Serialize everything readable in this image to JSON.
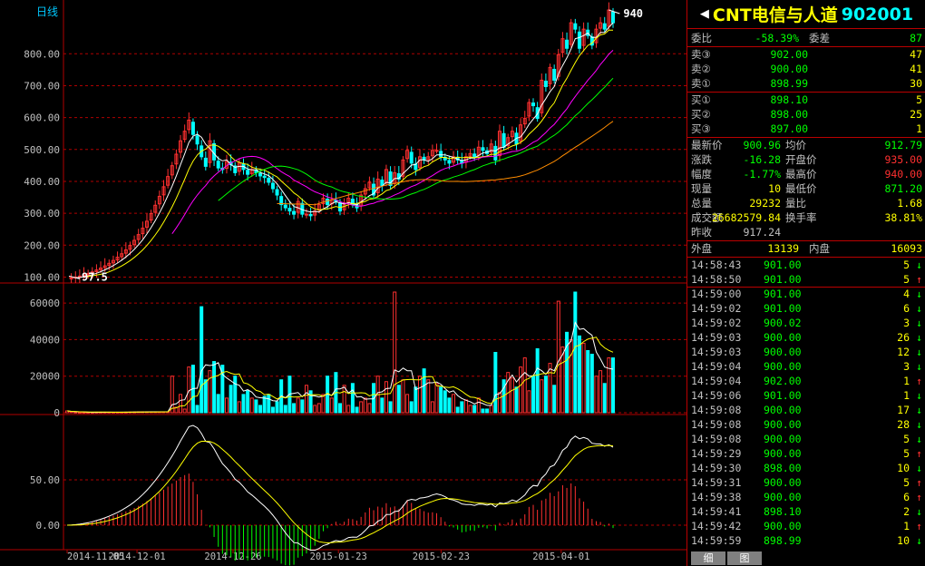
{
  "header": {
    "period": "日线",
    "stock_name": "CNT电信与人道",
    "stock_code": "902001",
    "triangle_left": "◀",
    "triangle_right": "▶"
  },
  "price_axis": [
    "800.00",
    "700.00",
    "600.00",
    "500.00",
    "400.00",
    "300.00",
    "200.00",
    "100.00"
  ],
  "volume_axis": [
    "60000",
    "40000",
    "20000",
    "0"
  ],
  "macd_axis": [
    "50.00",
    "0.00"
  ],
  "date_axis": [
    "2014-11-05",
    "2014-12-01",
    "2014-12-26",
    "2015-01-23",
    "2015-02-23",
    "2015-04-01"
  ],
  "annotations": {
    "high": "940",
    "low": "97.5"
  },
  "colors": {
    "up": "#ff3030",
    "down": "#00ffff",
    "grid": "#b00000",
    "ma5": "#ffffff",
    "ma10": "#ffff00",
    "ma20": "#ff00ff",
    "ma30": "#00ff00",
    "ma60": "#ff8c00"
  },
  "order_book": {
    "weibi_label": "委比",
    "weibi_value": "-58.39%",
    "weicha_label": "委差",
    "weicha_value": "87",
    "asks": [
      {
        "label": "卖③",
        "price": "902.00",
        "qty": "47"
      },
      {
        "label": "卖②",
        "price": "900.00",
        "qty": "41"
      },
      {
        "label": "卖①",
        "price": "898.99",
        "qty": "30"
      }
    ],
    "bids": [
      {
        "label": "买①",
        "price": "898.10",
        "qty": "5"
      },
      {
        "label": "买②",
        "price": "898.00",
        "qty": "25"
      },
      {
        "label": "买③",
        "price": "897.00",
        "qty": "1"
      }
    ]
  },
  "quote": {
    "rows": [
      {
        "l1": "最新价",
        "v1": "900.96",
        "l2": "均价",
        "v2": "912.79",
        "c1": "#00ff00",
        "c2": "#00ff00"
      },
      {
        "l1": "涨跌",
        "v1": "-16.28",
        "l2": "开盘价",
        "v2": "935.00",
        "c1": "#00ff00",
        "c2": "#ff3030"
      },
      {
        "l1": "幅度",
        "v1": "-1.77%",
        "l2": "最高价",
        "v2": "940.00",
        "c1": "#00ff00",
        "c2": "#ff3030"
      },
      {
        "l1": "现量",
        "v1": "10",
        "l2": "最低价",
        "v2": "871.20",
        "c1": "#ffff00",
        "c2": "#00ff00"
      },
      {
        "l1": "总量",
        "v1": "29232",
        "l2": "量比",
        "v2": "1.68",
        "c1": "#ffff00",
        "c2": "#ffff00"
      },
      {
        "l1": "成交额",
        "v1": "26682579.84",
        "l2": "换手率",
        "v2": "38.81%",
        "c1": "#ffff00",
        "c2": "#ffff00"
      }
    ],
    "prev_close_label": "昨收",
    "prev_close": "917.24",
    "outer_label": "外盘",
    "outer_value": "13139",
    "inner_label": "内盘",
    "inner_value": "16093"
  },
  "ticks": [
    {
      "time": "14:58:43",
      "price": "901.00",
      "qty": "5",
      "dir": "down"
    },
    {
      "time": "14:58:50",
      "price": "901.00",
      "qty": "5",
      "dir": "up"
    },
    {
      "time": "14:59:00",
      "price": "901.00",
      "qty": "4",
      "dir": "down"
    },
    {
      "time": "14:59:02",
      "price": "901.00",
      "qty": "6",
      "dir": "down"
    },
    {
      "time": "14:59:02",
      "price": "900.02",
      "qty": "3",
      "dir": "down"
    },
    {
      "time": "14:59:03",
      "price": "900.00",
      "qty": "26",
      "dir": "down"
    },
    {
      "time": "14:59:03",
      "price": "900.00",
      "qty": "12",
      "dir": "down"
    },
    {
      "time": "14:59:04",
      "price": "900.00",
      "qty": "3",
      "dir": "down"
    },
    {
      "time": "14:59:04",
      "price": "902.00",
      "qty": "1",
      "dir": "up"
    },
    {
      "time": "14:59:06",
      "price": "901.00",
      "qty": "1",
      "dir": "down"
    },
    {
      "time": "14:59:08",
      "price": "900.00",
      "qty": "17",
      "dir": "down"
    },
    {
      "time": "14:59:08",
      "price": "900.00",
      "qty": "28",
      "dir": "down"
    },
    {
      "time": "14:59:08",
      "price": "900.00",
      "qty": "5",
      "dir": "down"
    },
    {
      "time": "14:59:29",
      "price": "900.00",
      "qty": "5",
      "dir": "up"
    },
    {
      "time": "14:59:30",
      "price": "898.00",
      "qty": "10",
      "dir": "down"
    },
    {
      "time": "14:59:31",
      "price": "900.00",
      "qty": "5",
      "dir": "up"
    },
    {
      "time": "14:59:38",
      "price": "900.00",
      "qty": "6",
      "dir": "up"
    },
    {
      "time": "14:59:41",
      "price": "898.10",
      "qty": "2",
      "dir": "down"
    },
    {
      "time": "14:59:42",
      "price": "900.00",
      "qty": "1",
      "dir": "up"
    },
    {
      "time": "14:59:59",
      "price": "898.99",
      "qty": "10",
      "dir": "down"
    }
  ],
  "tabs": {
    "detail": "细",
    "chart": "图"
  },
  "chart_data": [
    {
      "type": "candlestick",
      "title": "",
      "ylim": [
        90,
        960
      ],
      "x_dates": [
        "2014-11-05",
        "2014-12-01",
        "2014-12-26",
        "2015-01-23",
        "2015-02-23",
        "2015-04-01"
      ],
      "close": [
        97.5,
        100,
        103,
        106,
        110,
        114,
        119,
        125,
        131,
        138,
        146,
        155,
        165,
        176,
        188,
        202,
        218,
        236,
        256,
        278,
        302,
        328,
        356,
        386,
        418,
        452,
        488,
        530,
        560,
        595,
        550,
        520,
        480,
        450,
        530,
        470,
        445,
        440,
        465,
        455,
        430,
        460,
        440,
        425,
        440,
        430,
        420,
        415,
        400,
        380,
        360,
        330,
        320,
        310,
        300,
        340,
        300,
        300,
        295,
        310,
        330,
        350,
        330,
        345,
        340,
        310,
        335,
        350,
        330,
        320,
        360,
        380,
        400,
        360,
        410,
        390,
        440,
        390,
        430,
        410,
        470,
        500,
        460,
        440,
        480,
        470,
        480,
        500,
        500,
        480,
        470,
        460,
        480,
        470,
        460,
        480,
        490,
        480,
        510,
        500,
        490,
        520,
        470,
        560,
        510,
        540,
        560,
        520,
        580,
        600,
        650,
        640,
        600,
        720,
        700,
        760,
        720,
        800,
        850,
        820,
        900,
        880,
        820,
        880,
        860,
        830,
        880,
        900,
        880,
        940,
        900
      ],
      "volume": [
        1000,
        500,
        300,
        200,
        200,
        200,
        200,
        300,
        300,
        300,
        300,
        300,
        300,
        300,
        300,
        400,
        400,
        500,
        500,
        500,
        500,
        500,
        500,
        500,
        500,
        20000,
        3000,
        10000,
        2000,
        25000,
        26000,
        4000,
        58000,
        18000,
        23000,
        28000,
        10000,
        26000,
        8000,
        15000,
        20000,
        6000,
        10000,
        12000,
        8000,
        7000,
        4000,
        9000,
        10000,
        3000,
        6000,
        18000,
        4000,
        20000,
        5000,
        8000,
        7000,
        15000,
        12000,
        4000,
        5000,
        10000,
        20000,
        8000,
        22000,
        5000,
        15000,
        4000,
        16000,
        3000,
        6000,
        8000,
        5000,
        16000,
        20000,
        8000,
        17000,
        6000,
        66000,
        15000,
        18000,
        10000,
        6000,
        14000,
        20000,
        24000,
        18000,
        6000,
        16000,
        14000,
        12000,
        8000,
        10000,
        3000,
        6000,
        7000,
        4000,
        4000,
        8000,
        2000,
        2000,
        4000,
        33000,
        11000,
        18000,
        22000,
        19000,
        14000,
        25000,
        30000,
        12000,
        20000,
        35000,
        18000,
        20000,
        27000,
        15000,
        61000,
        36000,
        44000,
        40000,
        66000,
        42000,
        38000,
        34000,
        32000,
        20000,
        23000,
        16000,
        30000,
        30000
      ]
    }
  ]
}
